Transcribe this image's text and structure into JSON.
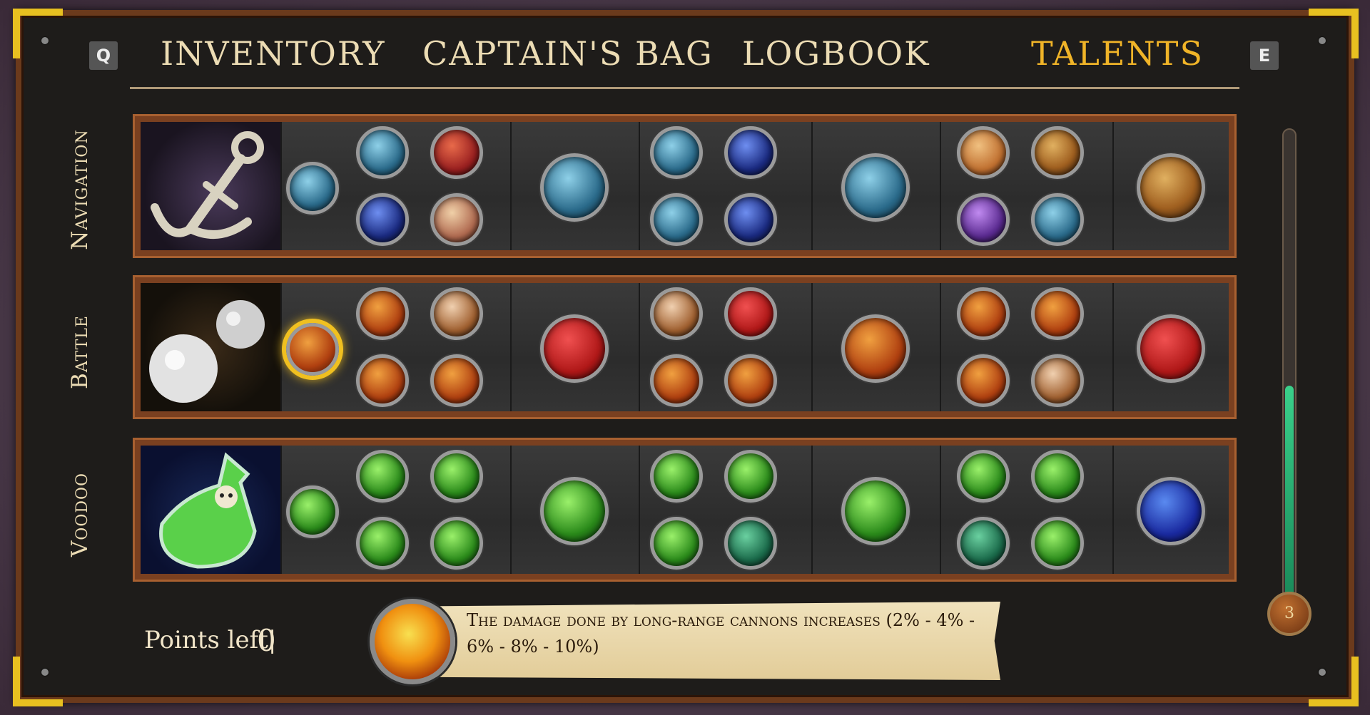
{
  "tabs": {
    "prev_key": "Q",
    "next_key": "E",
    "inventory": "INVENTORY",
    "captains_bag": "CAPTAIN'S BAG",
    "logbook": "LOGBOOK",
    "talents": "TALENTS",
    "active": "talents"
  },
  "rows": [
    {
      "label": "Navigation"
    },
    {
      "label": "Battle"
    },
    {
      "label": "Voodoo"
    }
  ],
  "footer": {
    "points_label": "Points left|",
    "points_value": "0",
    "description": "The damage done by long-range cannons increases (2% - 4% - 6% - 8% - 10%)",
    "level_badge": "3"
  },
  "scrollbar": {
    "fill_fraction": 0.45
  },
  "colors": {
    "active_tab": "#f0b428",
    "tab_text": "#ecdcb4",
    "selection_glow": "#f0c020",
    "scroll_fill": "#3ad08a"
  }
}
